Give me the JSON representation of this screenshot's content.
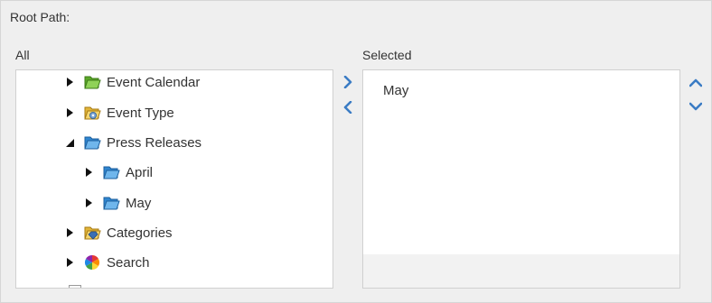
{
  "labels": {
    "root_path": "Root Path:",
    "all": "All",
    "selected": "Selected"
  },
  "tree": [
    {
      "label": "Event Calendar",
      "state": "collapsed",
      "icon": "folder-green-icon",
      "depth": 1
    },
    {
      "label": "Event Type",
      "state": "collapsed",
      "icon": "folder-gear-icon",
      "depth": 1
    },
    {
      "label": "Press Releases",
      "state": "expanded",
      "icon": "folder-blue-icon",
      "depth": 1
    },
    {
      "label": "April",
      "state": "collapsed",
      "icon": "folder-blue-icon",
      "depth": 2
    },
    {
      "label": "May",
      "state": "collapsed",
      "icon": "folder-blue-icon",
      "depth": 2
    },
    {
      "label": "Categories",
      "state": "collapsed",
      "icon": "folder-tag-icon",
      "depth": 1
    },
    {
      "label": "Search",
      "state": "collapsed",
      "icon": "search-color-wheel-icon",
      "depth": 1
    }
  ],
  "selected_items": [
    "May"
  ],
  "buttons": {
    "add": "chevron-right-icon",
    "remove": "chevron-left-icon",
    "move_up": "chevron-up-icon",
    "move_down": "chevron-down-icon"
  },
  "colors": {
    "accent": "#3b7cc4",
    "background": "#efefef",
    "panel": "#ffffff"
  }
}
